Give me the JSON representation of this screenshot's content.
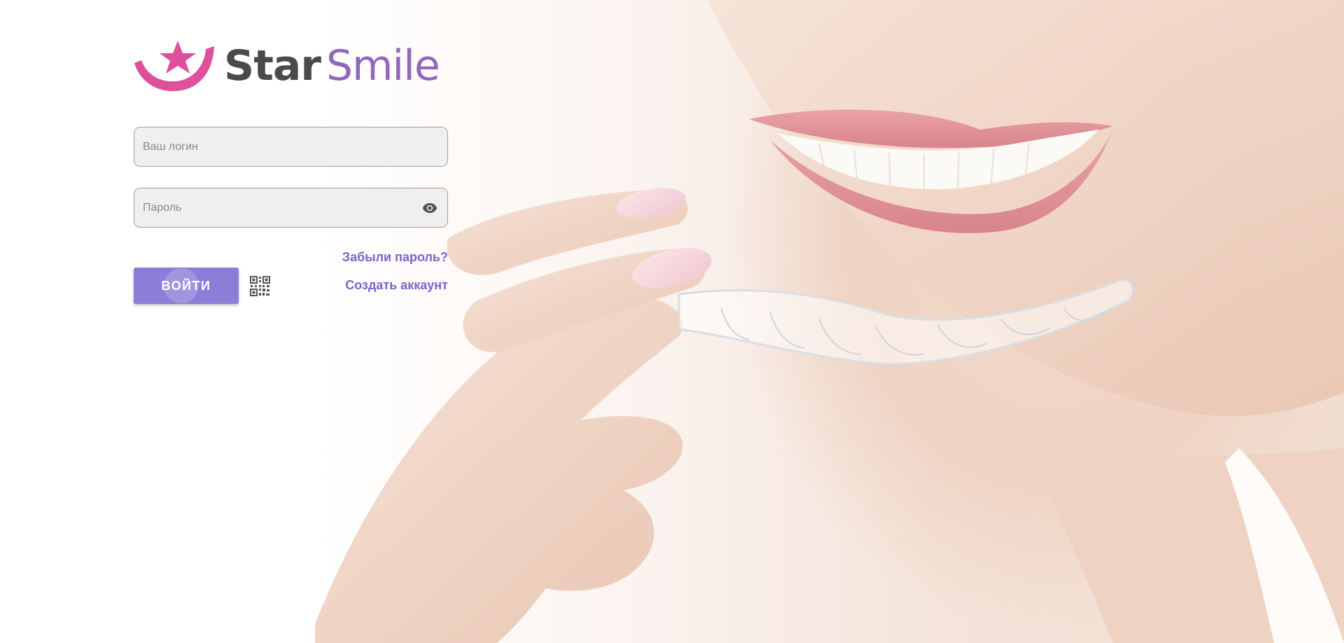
{
  "brand": {
    "name_part1": "Star",
    "name_part2": "Smile",
    "logo_icon": "star-crescent-logo",
    "colors": {
      "star": "#4a4a4c",
      "smile": "#9067bd",
      "mark": "#de4f9c"
    }
  },
  "login_form": {
    "login_placeholder": "Ваш логин",
    "password_placeholder": "Пароль",
    "password_toggle_icon": "eye-icon",
    "forgot_password_link": "Забыли пароль?",
    "create_account_link": "Создать аккаунт",
    "submit_label": "ВОЙТИ",
    "qr_login_icon": "qr-code-icon"
  },
  "theme": {
    "accent": "#8b7ed8",
    "link": "#7b64c9",
    "field_bg": "#efefef"
  }
}
